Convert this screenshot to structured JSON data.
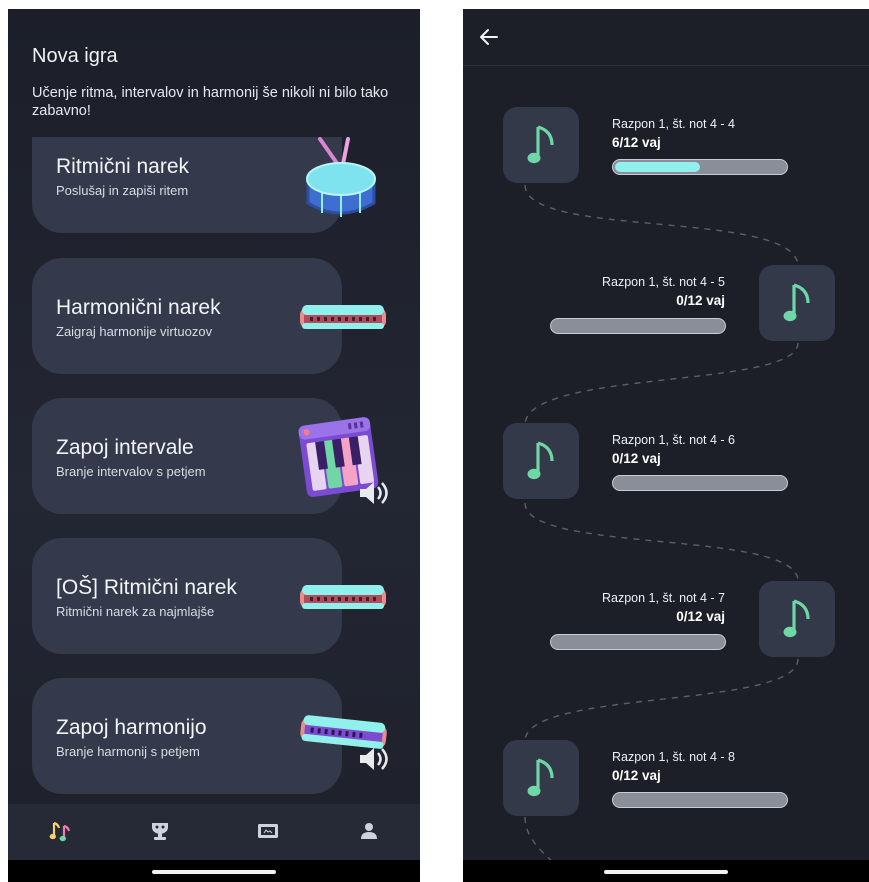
{
  "left_screen": {
    "title": "Nova igra",
    "subtitle": "Učenje ritma, intervalov in harmonij še nikoli ni bilo tako zabavno!",
    "cards": [
      {
        "title": "Ritmični narek",
        "subtitle": "Poslušaj in zapiši ritem",
        "icon": "drum-icon"
      },
      {
        "title": "Harmonični narek",
        "subtitle": "Zaigraj harmonije virtuozov",
        "icon": "harmonica-icon"
      },
      {
        "title": "Zapoj intervale",
        "subtitle": "Branje intervalov s petjem",
        "icon": "piano-speaker-icon"
      },
      {
        "title": "[OŠ] Ritmični narek",
        "subtitle": "Ritmični narek za najmlajše",
        "icon": "harmonica-icon"
      },
      {
        "title": "Zapoj harmonijo",
        "subtitle": "Branje harmonij s petjem",
        "icon": "harmonica-speaker-icon"
      }
    ],
    "nav": [
      {
        "icon": "music-notes-icon",
        "active": true
      },
      {
        "icon": "trophy-icon",
        "active": false
      },
      {
        "icon": "certificate-icon",
        "active": false
      },
      {
        "icon": "user-icon",
        "active": false
      }
    ]
  },
  "right_screen": {
    "back_icon": "arrow-left-icon",
    "levels": [
      {
        "label": "Razpon 1, št. not 4 - 4",
        "count": "6/12 vaj",
        "progress": 0.5,
        "side": "left"
      },
      {
        "label": "Razpon 1, št. not 4 - 5",
        "count": "0/12 vaj",
        "progress": 0,
        "side": "right"
      },
      {
        "label": "Razpon 1, št. not 4 - 6",
        "count": "0/12 vaj",
        "progress": 0,
        "side": "left"
      },
      {
        "label": "Razpon 1, št. not 4 - 7",
        "count": "0/12 vaj",
        "progress": 0,
        "side": "right"
      },
      {
        "label": "Razpon 1, št. not 4 - 8",
        "count": "0/12 vaj",
        "progress": 0,
        "side": "left"
      }
    ]
  },
  "colors": {
    "background": "#1c1f28",
    "card": "#343a4b",
    "accent_note": "#6fd6a5",
    "progress_fill": "#8ff0ec",
    "progress_track": "#8a8e98"
  }
}
